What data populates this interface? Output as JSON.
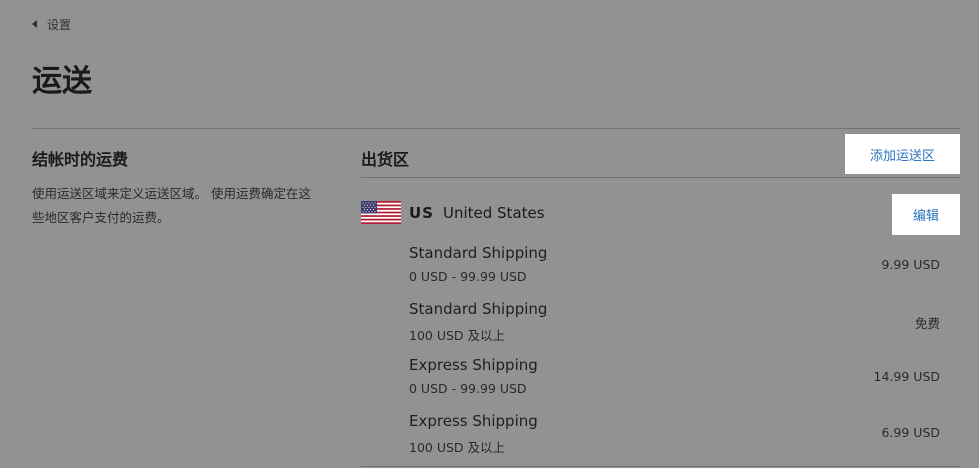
{
  "breadcrumb": {
    "label": "设置"
  },
  "page": {
    "title": "运送"
  },
  "checkout_section": {
    "heading": "结帐时的运费",
    "description": "使用运送区域来定义运送区域。 使用运费确定在这些地区客户支付的运费。"
  },
  "zones": {
    "heading": "出货区",
    "add_button_label": "添加运送区",
    "zone": {
      "country_code": "US",
      "country_name": "United States",
      "flag_icon": "us-flag-icon",
      "edit_label": "编辑",
      "rates": [
        {
          "name": "Standard Shipping",
          "condition": "0 USD - 99.99 USD",
          "price": "9.99 USD"
        },
        {
          "name": "Standard Shipping",
          "condition": "100 USD 及以上",
          "price": "免费"
        },
        {
          "name": "Express Shipping",
          "condition": "0 USD - 99.99 USD",
          "price": "14.99 USD"
        },
        {
          "name": "Express Shipping",
          "condition": "100 USD 及以上",
          "price": "6.99 USD"
        }
      ]
    }
  },
  "colors": {
    "background": "#929292",
    "link": "#2a72c0",
    "button_bg": "#ffffff"
  }
}
